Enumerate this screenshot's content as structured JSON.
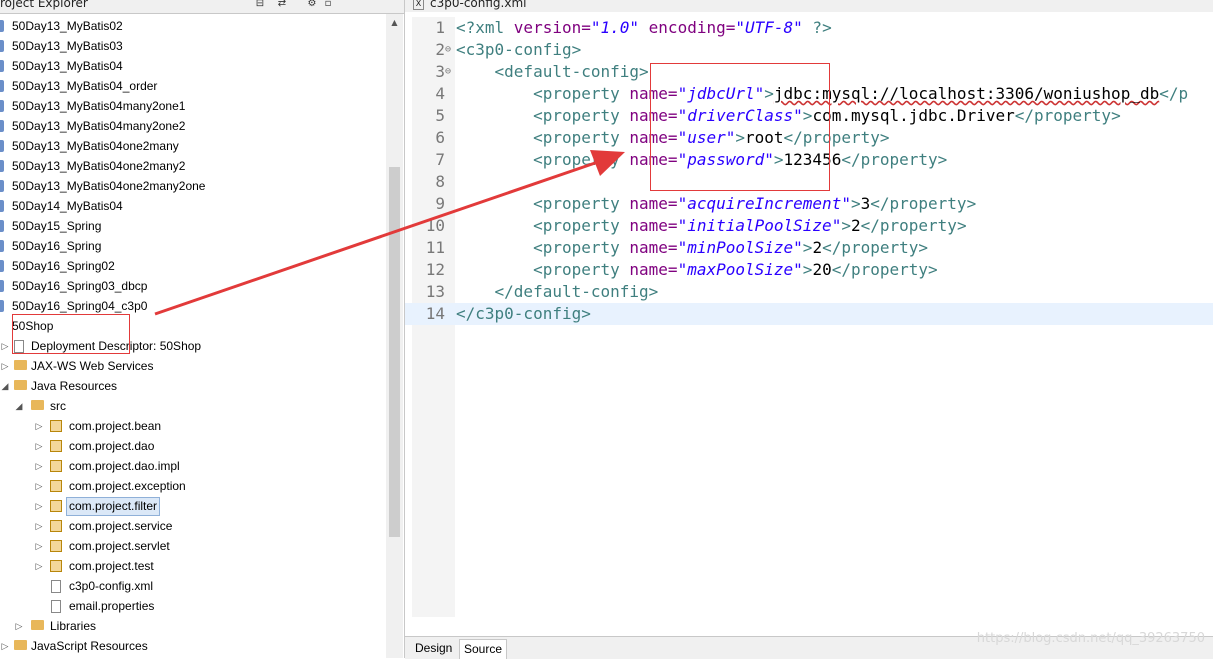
{
  "explorer": {
    "title": "roject Explorer",
    "items": [
      {
        "label": "50Day13_MyBatis02"
      },
      {
        "label": "50Day13_MyBatis03"
      },
      {
        "label": "50Day13_MyBatis04"
      },
      {
        "label": "50Day13_MyBatis04_order"
      },
      {
        "label": "50Day13_MyBatis04many2one1"
      },
      {
        "label": "50Day13_MyBatis04many2one2"
      },
      {
        "label": "50Day13_MyBatis04one2many"
      },
      {
        "label": "50Day13_MyBatis04one2many2"
      },
      {
        "label": "50Day13_MyBatis04one2many2one"
      },
      {
        "label": "50Day14_MyBatis04"
      },
      {
        "label": "50Day15_Spring"
      },
      {
        "label": "50Day16_Spring"
      },
      {
        "label": "50Day16_Spring02"
      },
      {
        "label": "50Day16_Spring03_dbcp"
      },
      {
        "label": "50Day16_Spring04_c3p0"
      },
      {
        "label": "50Shop"
      },
      {
        "label": "Deployment Descriptor: 50Shop"
      },
      {
        "label": "JAX-WS Web Services"
      },
      {
        "label": "Java Resources"
      },
      {
        "label": "src"
      },
      {
        "label": "com.project.bean"
      },
      {
        "label": "com.project.dao"
      },
      {
        "label": "com.project.dao.impl"
      },
      {
        "label": "com.project.exception"
      },
      {
        "label": "com.project.filter"
      },
      {
        "label": "com.project.service"
      },
      {
        "label": "com.project.servlet"
      },
      {
        "label": "com.project.test"
      },
      {
        "label": "c3p0-config.xml"
      },
      {
        "label": "email.properties"
      },
      {
        "label": "Libraries"
      },
      {
        "label": "JavaScript Resources"
      }
    ]
  },
  "editor": {
    "tab_label": "c3p0-config.xml",
    "lines": [
      {
        "n": "1",
        "a": "<?xml ",
        "b": "version=",
        "c": "\"1.0\"",
        "d": " encoding=",
        "e": "\"UTF-8\"",
        "f": " ?>"
      },
      {
        "n": "2",
        "a": "<c3p0-config>"
      },
      {
        "n": "3",
        "a": "    <default-config>"
      },
      {
        "n": "4",
        "a": "        <property ",
        "b": "name=",
        "c": "\"jdbcUrl\"",
        "d": ">",
        "e": "jdbc:mysql://localhost:3306/woniushop_db",
        "f": "</p"
      },
      {
        "n": "5",
        "a": "        <property ",
        "b": "name=",
        "c": "\"driverClass\"",
        "d": ">",
        "e": "com.mysql.jdbc.Driver",
        "f": "</property>"
      },
      {
        "n": "6",
        "a": "        <property ",
        "b": "name=",
        "c": "\"user\"",
        "d": ">",
        "e": "root",
        "f": "</property>"
      },
      {
        "n": "7",
        "a": "        <property ",
        "b": "name=",
        "c": "\"password\"",
        "d": ">",
        "e": "123456",
        "f": "</property>"
      },
      {
        "n": "8"
      },
      {
        "n": "9",
        "a": "        <property ",
        "b": "name=",
        "c": "\"acquireIncrement\"",
        "d": ">",
        "e": "3",
        "f": "</property>"
      },
      {
        "n": "10",
        "a": "        <property ",
        "b": "name=",
        "c": "\"initialPoolSize\"",
        "d": ">",
        "e": "2",
        "f": "</property>"
      },
      {
        "n": "11",
        "a": "        <property ",
        "b": "name=",
        "c": "\"minPoolSize\"",
        "d": ">",
        "e": "2",
        "f": "</property>"
      },
      {
        "n": "12",
        "a": "        <property ",
        "b": "name=",
        "c": "\"maxPoolSize\"",
        "d": ">",
        "e": "20",
        "f": "</property>"
      },
      {
        "n": "13",
        "a": "    </default-config>"
      },
      {
        "n": "14",
        "a": "</c3p0-config>"
      }
    ],
    "bottom_tabs": {
      "design": "Design",
      "source": "Source"
    },
    "watermark": "https://blog.csdn.net/qq_39263750"
  },
  "colors": {
    "annotation": "#e23a3a",
    "xml_tag": "#3f7f7f",
    "xml_attr": "#7f007f",
    "xml_value": "#2a00ff"
  }
}
